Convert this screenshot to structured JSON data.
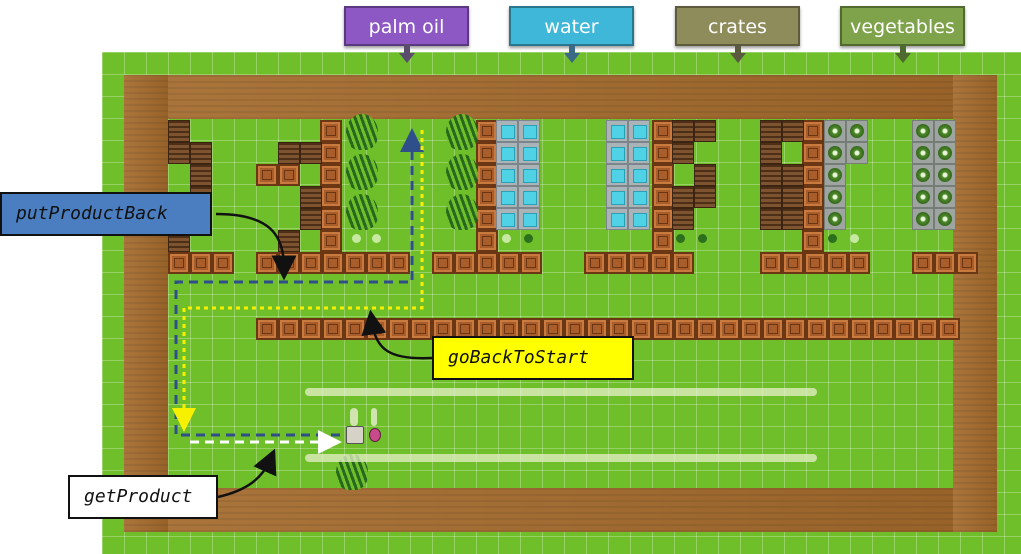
{
  "signs": [
    {
      "id": "palm-oil",
      "label": "palm oil",
      "color": "#8d58c3"
    },
    {
      "id": "water",
      "label": "water",
      "color": "#3fb7d9"
    },
    {
      "id": "crates",
      "label": "crates",
      "color": "#8f8c5c"
    },
    {
      "id": "vegetables",
      "label": "vegetables",
      "color": "#7fa34a"
    }
  ],
  "callouts": {
    "put_product_back": "putProductBack",
    "go_back_to_start": "goBackToStart",
    "get_product": "getProduct"
  },
  "colors": {
    "grass": "#6fbf2a",
    "dirt": "#a36a2c",
    "path_blue": "#2f4f8a",
    "path_yellow": "#f7f000",
    "path_white": "#ffffff",
    "put_label_bg": "#4a7ec0",
    "go_label_bg": "#ffff00",
    "get_label_bg": "#ffffff"
  }
}
